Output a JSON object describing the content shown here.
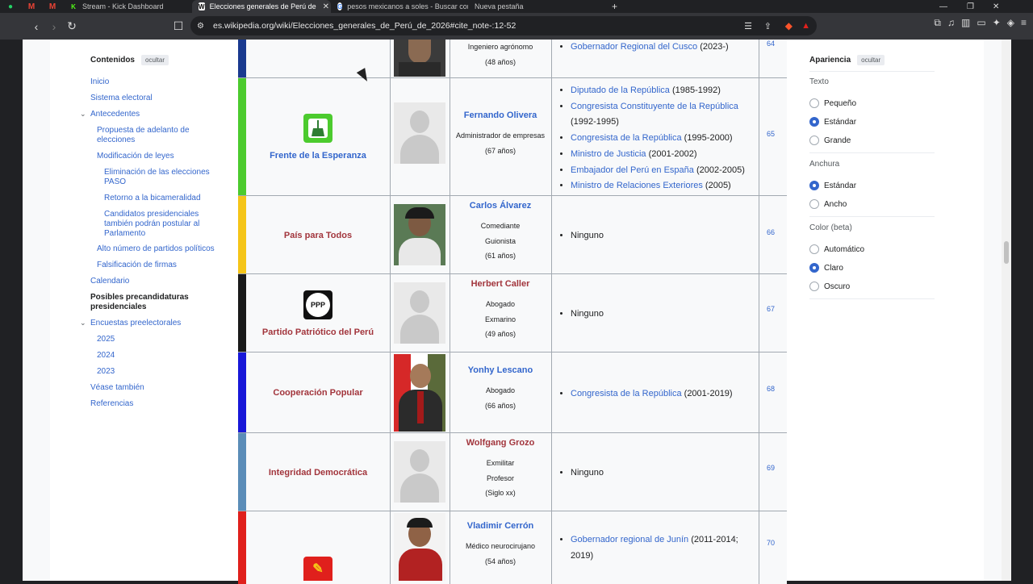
{
  "tabs": [
    {
      "label": "Stream - Kick Dashboard",
      "active": false
    },
    {
      "label": "Elecciones generales de Perú de",
      "active": true
    },
    {
      "label": "pesos mexicanos a soles - Buscar con",
      "active": false
    },
    {
      "label": "Nueva pestaña",
      "active": false
    }
  ],
  "url": "es.wikipedia.org/wiki/Elecciones_generales_de_Perú_de_2026#cite_note-:12-52",
  "toc": {
    "title": "Contenidos",
    "hide": "ocultar",
    "items": [
      "Inicio",
      "Sistema electoral",
      "Antecedentes",
      "Propuesta de adelanto de elecciones",
      "Modificación de leyes",
      "Eliminación de las elecciones PASO",
      "Retorno a la bicameralidad",
      "Candidatos presidenciales también podrán postular al Parlamento",
      "Alto número de partidos políticos",
      "Falsificación de firmas",
      "Calendario",
      "Posibles precandidaturas presidenciales",
      "Encuestas preelectorales",
      "2025",
      "2024",
      "2023",
      "Véase también",
      "Referencias"
    ]
  },
  "appearance": {
    "title": "Apariencia",
    "hide": "ocultar",
    "text_label": "Texto",
    "text_options": [
      "Pequeño",
      "Estándar",
      "Grande"
    ],
    "width_label": "Anchura",
    "width_options": [
      "Estándar",
      "Ancho"
    ],
    "color_label": "Color (beta)",
    "color_options": [
      "Automático",
      "Claro",
      "Oscuro"
    ]
  },
  "rows": [
    {
      "party": "",
      "bar_color": "#1a3a8f",
      "candidate": "",
      "lines": [
        "Ingeniero agrónomo",
        "(48 años)"
      ],
      "posts": [
        {
          "link": "Gobernador Regional del Cusco",
          "years": "(2023-)"
        }
      ],
      "ref": "64"
    },
    {
      "party": "Frente de la Esperanza",
      "party_color": "#3366cc",
      "bar_color": "#4ccb2e",
      "candidate": "Fernando Olivera",
      "cand_color": "#3366cc",
      "lines": [
        "Administrador de empresas",
        "(67 años)"
      ],
      "posts": [
        {
          "link": "Diputado de la República",
          "years": "(1985-1992)"
        },
        {
          "link": "Congresista Constituyente de la República",
          "years": "(1992-1995)"
        },
        {
          "link": "Congresista de la República",
          "years": "(1995-2000)"
        },
        {
          "link": "Ministro de Justicia",
          "years": "(2001-2002)"
        },
        {
          "link": "Embajador del Perú en España",
          "years": "(2002-2005)"
        },
        {
          "link": "Ministro de Relaciones Exteriores",
          "years": "(2005)"
        }
      ],
      "ref": "65"
    },
    {
      "party": "País para Todos",
      "party_color": "#a2353c",
      "bar_color": "#f5c518",
      "candidate": "Carlos Álvarez",
      "cand_color": "#3366cc",
      "lines": [
        "Comediante",
        "Guionista",
        "(61 años)"
      ],
      "none": "Ninguno",
      "ref": "66"
    },
    {
      "party": "Partido Patriótico del Perú",
      "party_color": "#a2353c",
      "bar_color": "#1a1a1a",
      "logo_text": "PPP",
      "candidate": "Herbert Caller",
      "cand_color": "#a2353c",
      "lines": [
        "Abogado",
        "Exmarino",
        "(49 años)"
      ],
      "none": "Ninguno",
      "ref": "67"
    },
    {
      "party": "Cooperación Popular",
      "party_color": "#a2353c",
      "bar_color": "#1818d8",
      "candidate": "Yonhy Lescano",
      "cand_color": "#3366cc",
      "lines": [
        "Abogado",
        "(66 años)"
      ],
      "posts": [
        {
          "link": "Congresista de la República",
          "years": "(2001-2019)"
        }
      ],
      "ref": "68"
    },
    {
      "party": "Integridad Democrática",
      "party_color": "#a2353c",
      "bar_color": "#5b8db8",
      "candidate": "Wolfgang Grozo",
      "cand_color": "#a2353c",
      "lines": [
        "Exmilitar",
        "Profesor",
        "(Siglo xx)"
      ],
      "none": "Ninguno",
      "ref": "69"
    },
    {
      "party": "",
      "bar_color": "#e0201c",
      "candidate": "Vladimir Cerrón",
      "cand_color": "#3366cc",
      "lines": [
        "Médico neurocirujano",
        "(54 años)"
      ],
      "posts": [
        {
          "link": "Gobernador regional de Junín",
          "years": "(2011-2014; 2019)"
        }
      ],
      "ref": "70"
    }
  ]
}
